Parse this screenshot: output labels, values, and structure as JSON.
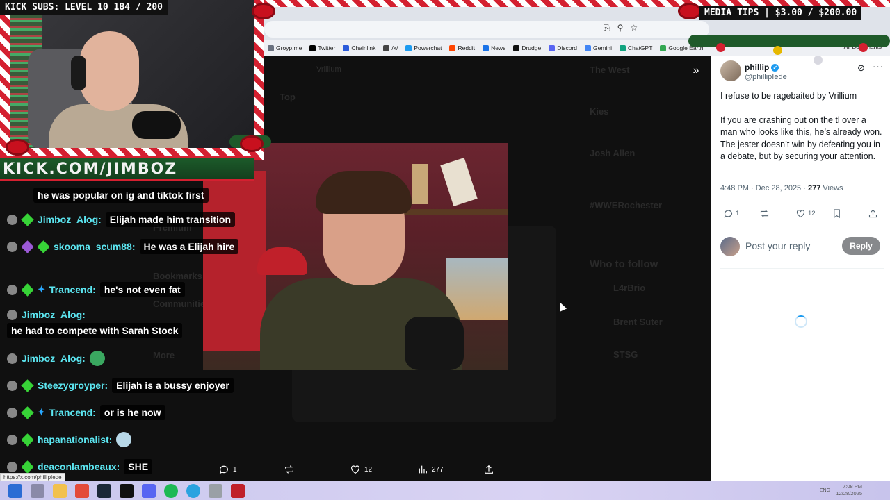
{
  "overlays": {
    "kick_subs": "KICK SUBS: LEVEL 10 184 / 200",
    "media_tips": "MEDIA TIPS | $3.00 / $200.00",
    "kick_url": "KICK.COM/JIMBOZ"
  },
  "bookmarks": [
    "Groyp.me",
    "Twitter",
    "Chainlink",
    "/x/",
    "Powerchat",
    "Reddit",
    "News",
    "Drudge",
    "Discord",
    "Gemini",
    "ChatGPT",
    "Google Earth"
  ],
  "bookmark_colors": [
    "#6b7280",
    "#000000",
    "#2a5ada",
    "#444444",
    "#1d9bf0",
    "#ff4500",
    "#1a73e8",
    "#111111",
    "#5865f2",
    "#4285f4",
    "#10a37f",
    "#34a853"
  ],
  "bookmarks_all": "All Bookmarks",
  "tweet": {
    "display_name": "phillip",
    "handle": "@phillipIede",
    "paragraph1": "I refuse to be ragebaited by Vrillium",
    "paragraph2": "If you are crashing out on the tl over a man who looks like this, he’s already won. The jester doesn’t win by defeating you in a debate, but by securing your attention.",
    "time": "4:48 PM · Dec 28, 2025 · ",
    "views_count": "277",
    "views_label": " Views",
    "replies": "1",
    "likes": "12",
    "reply_placeholder": "Post your reply",
    "reply_button": "Reply"
  },
  "video_controls": {
    "replies": "1",
    "likes": "12",
    "views": "277"
  },
  "chat": [
    {
      "user": "",
      "text": "he was popular on ig and tiktok first",
      "badges": []
    },
    {
      "user": "Jimboz_Alog:",
      "text": "Elijah made him transition",
      "badges": [
        "gem"
      ]
    },
    {
      "user": "skooma_scum88:",
      "text": "He was a Elijah hire",
      "badges": [
        "sub",
        "gem"
      ]
    },
    {
      "user": "Trancend:",
      "text": "he's not even fat",
      "badges": [
        "gem",
        "sword"
      ]
    },
    {
      "user": "Jimboz_Alog:",
      "text": "he had to compete with Sarah Stock",
      "badges": []
    },
    {
      "user": "Jimboz_Alog:",
      "text": "",
      "badges": []
    },
    {
      "user": "Steezygroyper:",
      "text": "Elijah is a bussy enjoyer",
      "badges": [
        "gem"
      ]
    },
    {
      "user": "Trancend:",
      "text": "or is he now",
      "badges": [
        "gem",
        "sword"
      ]
    },
    {
      "user": "hapanationalist:",
      "text": "",
      "badges": [
        "gem"
      ]
    },
    {
      "user": "deaconlambeaux:",
      "text": "SHE",
      "badges": [
        "gem"
      ]
    }
  ],
  "status_url": "https://x.com/phillipIede",
  "ghost_page": {
    "search": "Vrillium",
    "tab_top": "Top",
    "sidebar_premium": "Premium",
    "sidebar_bookmarks": "Bookmarks",
    "sidebar_communities": "Communities",
    "sidebar_more": "More",
    "trend1": "The West",
    "trend2": "Kies",
    "trend3": "Josh Allen",
    "trend4": "#WWERochester",
    "who_to_follow": "Who to follow",
    "follow1": "L4rBrio",
    "follow2": "Brent Suter",
    "follow3": "STSG"
  },
  "tray": {
    "lang": "ENG",
    "time": "7:08 PM",
    "date": "12/28/2025"
  },
  "colors": {
    "accent": "#1d9bf0",
    "chat_username": "#5ce7f2",
    "candy_red": "#d42030",
    "overlay_bg": "#111111"
  }
}
